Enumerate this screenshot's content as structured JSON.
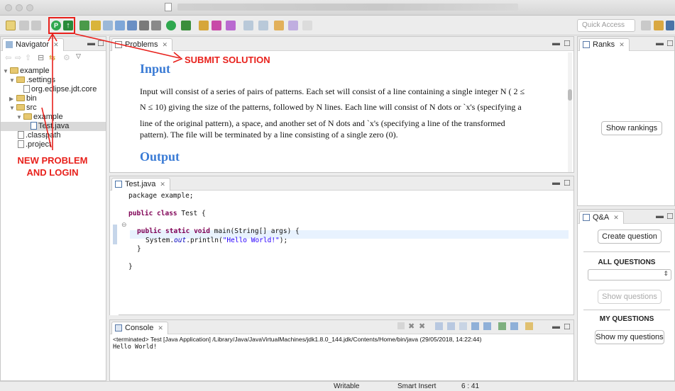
{
  "window": {
    "title": ""
  },
  "toolbar": {
    "quick_access_placeholder": "Quick Access"
  },
  "navigator": {
    "tab_label": "Navigator",
    "tree": [
      {
        "label": "example",
        "kind": "project",
        "depth": 0
      },
      {
        "label": ".settings",
        "kind": "folder",
        "depth": 1
      },
      {
        "label": "org.eclipse.jdt.core",
        "kind": "file",
        "depth": 2
      },
      {
        "label": "bin",
        "kind": "folder",
        "depth": 1
      },
      {
        "label": "src",
        "kind": "folder",
        "depth": 1
      },
      {
        "label": "example",
        "kind": "folder",
        "depth": 2
      },
      {
        "label": "Test.java",
        "kind": "java",
        "depth": 3,
        "selected": true
      },
      {
        "label": ".classpath",
        "kind": "xml",
        "depth": 1
      },
      {
        "label": ".project",
        "kind": "xml",
        "depth": 1
      }
    ]
  },
  "problems": {
    "tab_label": "Problems",
    "input_heading": "Input",
    "input_text_1": "Input will consist of a series of pairs of patterns. Each set will consist of a line containing a single integer N ( 2 ≤",
    "input_text_2": "N ≤ 10) giving the size of the patterns, followed by N lines. Each line will consist of N dots or `x's (specifying a",
    "input_text_3": "line of the original pattern), a space, and another set of N dots and `x's (specifying a line of the transformed",
    "input_text_4": "pattern). The file will be terminated by a line consisting of a single zero (0).",
    "output_heading": "Output"
  },
  "editor": {
    "tab_label": "Test.java",
    "lines": {
      "l1": "package example;",
      "l2_kw": "public class",
      "l2_rest": " Test {",
      "l3_kw": "public static void",
      "l3_rest": " main(String[] args) {",
      "l4_pre": "System.",
      "l4_fld": "out",
      "l4_mid": ".println(",
      "l4_str": "\"Hello World!\"",
      "l4_end": ");",
      "l5": "}",
      "l6": "}"
    }
  },
  "console": {
    "tab_label": "Console",
    "terminated_line": "<terminated> Test [Java Application] /Library/Java/JavaVirtualMachines/jdk1.8.0_144.jdk/Contents/Home/bin/java (29/05/2018, 14:22:44)",
    "output_line": "Hello World!"
  },
  "ranks": {
    "tab_label": "Ranks",
    "show_rankings_button": "Show rankings"
  },
  "qa": {
    "tab_label": "Q&A",
    "create_question_button": "Create question",
    "all_questions_title": "ALL QUESTIONS",
    "show_questions_button": "Show questions",
    "my_questions_title": "MY QUESTIONS",
    "show_my_questions_button": "Show my questions"
  },
  "status": {
    "writable": "Writable",
    "insert_mode": "Smart Insert",
    "cursor_position": "6 : 41"
  },
  "annotations": {
    "submit_solution": "SUBMIT SOLUTION",
    "new_problem_line1": "NEW PROBLEM",
    "new_problem_line2": "AND LOGIN",
    "accent_color": "#e8211c"
  }
}
